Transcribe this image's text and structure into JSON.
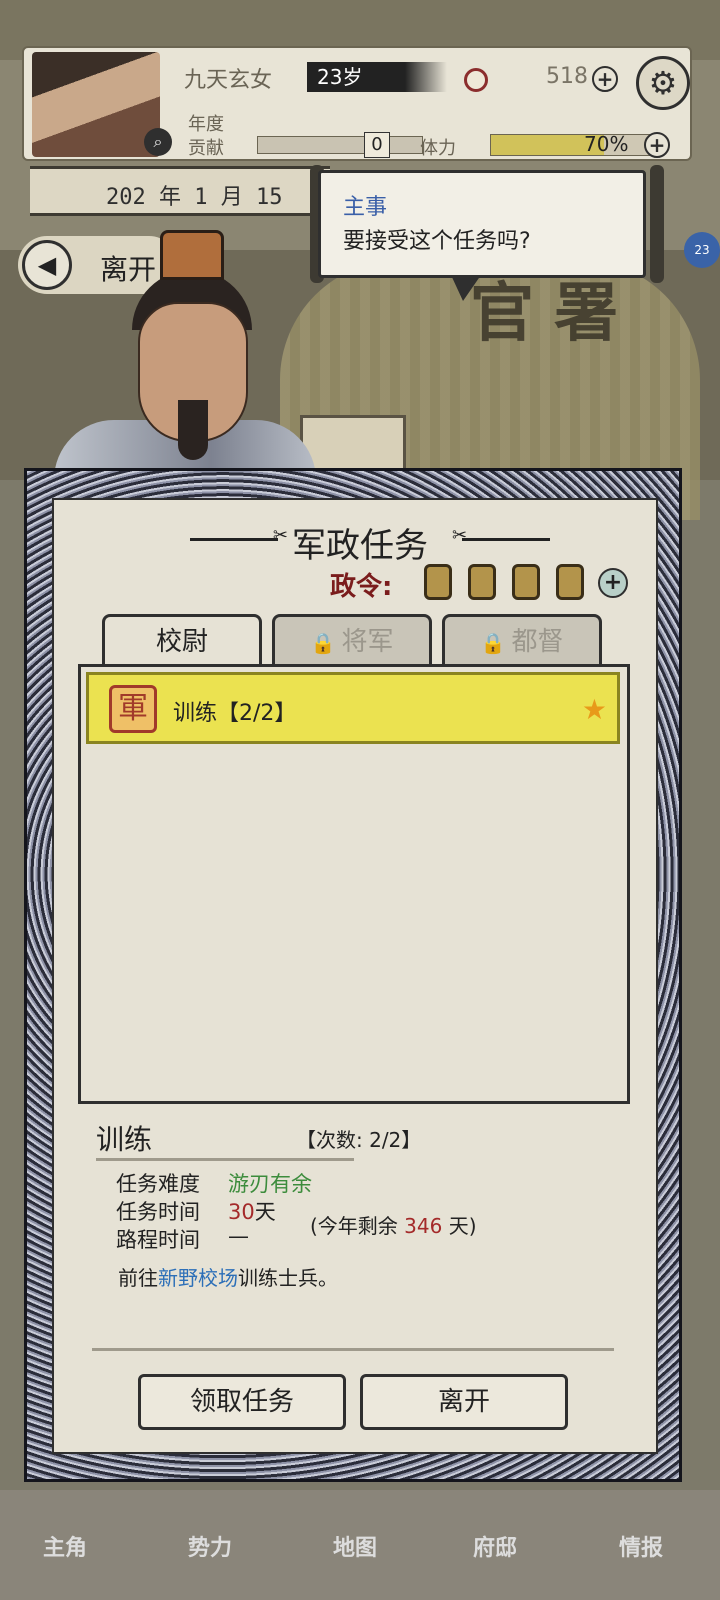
{
  "player": {
    "name": "九天玄女",
    "age": "23岁",
    "coins": "518",
    "year_label": "年度",
    "contrib_label": "贡献",
    "contrib_value": "0",
    "stamina_label": "体力",
    "stamina_value": "70%",
    "stamina_fraction": 0.7
  },
  "date": {
    "text": "202 年 1 月 15"
  },
  "top_leave": {
    "label": "离开"
  },
  "dialog": {
    "speaker": "主事",
    "text": "要接受这个任务吗?"
  },
  "background": {
    "sign": "官署"
  },
  "side_badge": {
    "text": "23"
  },
  "panel": {
    "title": "军政任务",
    "decree_label": "政令:",
    "decree_tokens": 4,
    "tabs": [
      {
        "label": "校尉",
        "locked": false
      },
      {
        "label": "将军",
        "locked": true
      },
      {
        "label": "都督",
        "locked": true
      }
    ],
    "tasks": [
      {
        "seal": "軍",
        "name": "训练【2/2】"
      }
    ],
    "detail": {
      "title": "训练",
      "count": "【次数: 2/2】",
      "difficulty_label": "任务难度",
      "difficulty_value": "游刃有余",
      "time_label": "任务时间",
      "time_value": "30",
      "time_unit": "天",
      "travel_label": "路程时间",
      "travel_value": "—",
      "remain_prefix": "(今年剩余 ",
      "remain_value": "346",
      "remain_suffix": " 天)",
      "desc_prefix": "前往",
      "desc_place": "新野校场",
      "desc_suffix": "训练士兵。"
    },
    "accept_label": "领取任务",
    "leave_label": "离开"
  },
  "nav": {
    "items": [
      "主角",
      "势力",
      "地图",
      "府邸",
      "情报"
    ]
  },
  "colors": {
    "highlight": "#ebe250",
    "decree_red": "#7a1c1c",
    "link_blue": "#2c6fb8",
    "green": "#3c8c3c"
  }
}
